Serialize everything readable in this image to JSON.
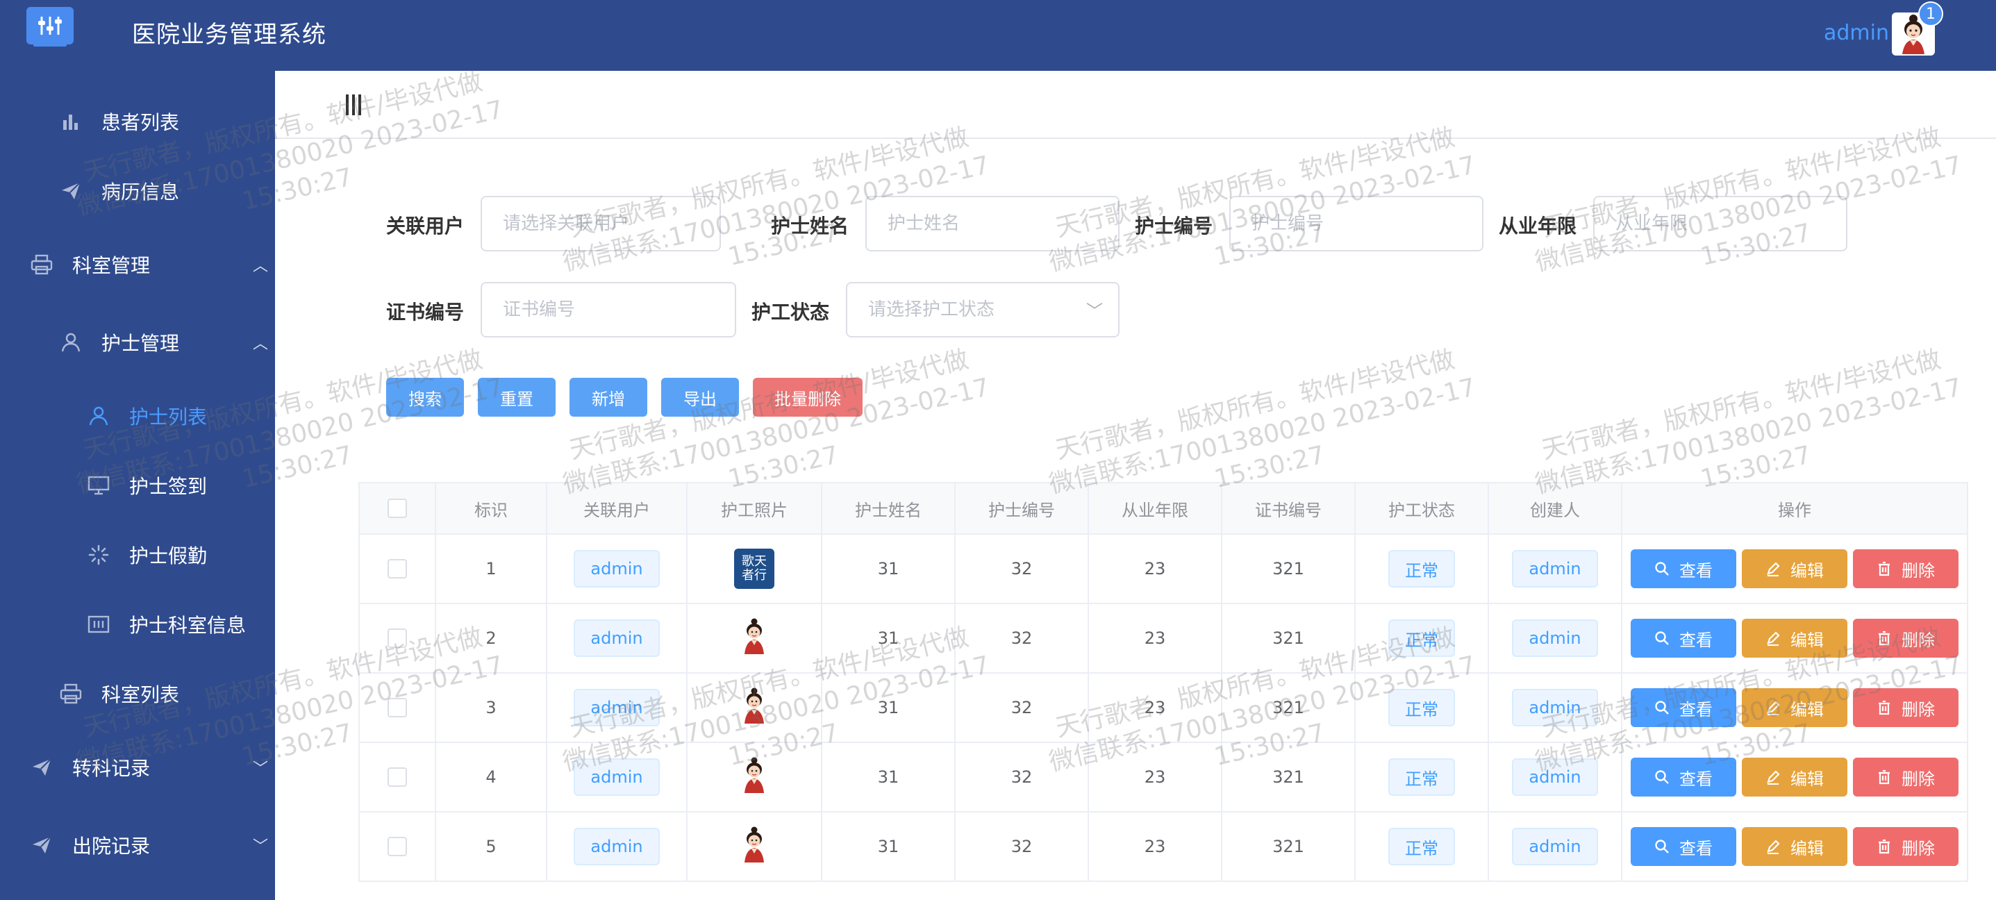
{
  "header": {
    "title": "医院业务管理系统",
    "user_name": "admin",
    "badge_count": "1"
  },
  "sidebar": {
    "items": [
      {
        "label": "患者列表",
        "icon": "bar-chart-icon"
      },
      {
        "label": "病历信息",
        "icon": "send-icon"
      },
      {
        "label": "科室管理",
        "icon": "printer-icon"
      },
      {
        "label": "护士管理",
        "icon": "user-icon"
      },
      {
        "label": "护士列表",
        "icon": "user-icon"
      },
      {
        "label": "护士签到",
        "icon": "monitor-icon"
      },
      {
        "label": "护士假勤",
        "icon": "loading-icon"
      },
      {
        "label": "护士科室信息",
        "icon": "grid-icon"
      },
      {
        "label": "科室列表",
        "icon": "printer-icon"
      },
      {
        "label": "转科记录",
        "icon": "send-icon"
      },
      {
        "label": "出院记录",
        "icon": "send-icon"
      }
    ]
  },
  "search": {
    "fields": [
      {
        "label": "关联用户",
        "placeholder": "请选择关联用户"
      },
      {
        "label": "护士姓名",
        "placeholder": "护士姓名"
      },
      {
        "label": "护士编号",
        "placeholder": "护士编号"
      },
      {
        "label": "从业年限",
        "placeholder": "从业年限"
      },
      {
        "label": "证书编号",
        "placeholder": "证书编号"
      },
      {
        "label": "护工状态",
        "placeholder": "请选择护工状态"
      }
    ],
    "buttons": {
      "search": "搜索",
      "reset": "重置",
      "add": "新增",
      "export": "导出",
      "batch_delete": "批量删除"
    }
  },
  "table": {
    "columns": [
      "标识",
      "关联用户",
      "护工照片",
      "护士姓名",
      "护士编号",
      "从业年限",
      "证书编号",
      "护工状态",
      "创建人",
      "操作"
    ],
    "rows": [
      {
        "id": "1",
        "user": "admin",
        "photo": "logo",
        "name": "31",
        "number": "32",
        "years": "23",
        "cert": "321",
        "status": "正常",
        "creator": "admin"
      },
      {
        "id": "2",
        "user": "admin",
        "photo": "avatar",
        "name": "31",
        "number": "32",
        "years": "23",
        "cert": "321",
        "status": "正常",
        "creator": "admin"
      },
      {
        "id": "3",
        "user": "admin",
        "photo": "avatar",
        "name": "31",
        "number": "32",
        "years": "23",
        "cert": "321",
        "status": "正常",
        "creator": "admin"
      },
      {
        "id": "4",
        "user": "admin",
        "photo": "avatar",
        "name": "31",
        "number": "32",
        "years": "23",
        "cert": "321",
        "status": "正常",
        "creator": "admin"
      },
      {
        "id": "5",
        "user": "admin",
        "photo": "avatar",
        "name": "31",
        "number": "32",
        "years": "23",
        "cert": "321",
        "status": "正常",
        "creator": "admin"
      }
    ],
    "actions": {
      "view": "查看",
      "edit": "编辑",
      "delete": "删除"
    },
    "logo_text": "歌天\n者行"
  },
  "watermark": {
    "line1": "天行歌者，版权所有。软件/毕设代做",
    "line2": "微信联系:17001380020 2023-02-17",
    "line3": "15:30:27"
  },
  "colors": {
    "nav_bg": "#2f4b8e",
    "accent": "#4a9cff",
    "danger": "#f06c6c",
    "warning": "#e6a23c"
  }
}
